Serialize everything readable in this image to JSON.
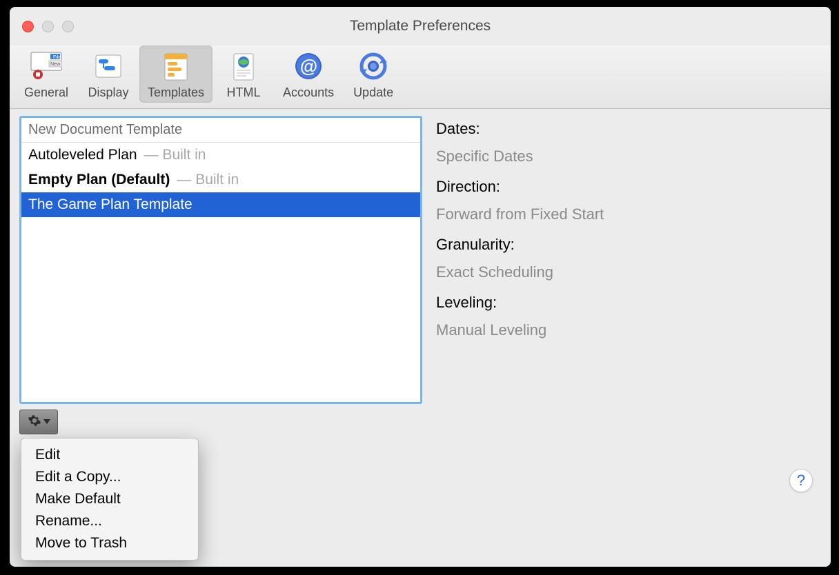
{
  "window": {
    "title": "Template Preferences"
  },
  "toolbar": {
    "items": [
      {
        "label": "General",
        "icon": "general-icon"
      },
      {
        "label": "Display",
        "icon": "display-icon"
      },
      {
        "label": "Templates",
        "icon": "templates-icon"
      },
      {
        "label": "HTML",
        "icon": "html-icon"
      },
      {
        "label": "Accounts",
        "icon": "accounts-icon"
      },
      {
        "label": "Update",
        "icon": "update-icon"
      }
    ],
    "selected_index": 2
  },
  "template_list": {
    "header": "New Document Template",
    "rows": [
      {
        "name": "Autoleveled Plan",
        "suffix": "— Built in",
        "bold": false,
        "selected": false
      },
      {
        "name": "Empty Plan (Default)",
        "suffix": "— Built in",
        "bold": true,
        "selected": false
      },
      {
        "name": "The Game Plan Template",
        "suffix": "",
        "bold": false,
        "selected": true
      }
    ]
  },
  "details": {
    "dates_label": "Dates:",
    "dates_value": "Specific Dates",
    "direction_label": "Direction:",
    "direction_value": "Forward from Fixed Start",
    "granularity_label": "Granularity:",
    "granularity_value": "Exact Scheduling",
    "leveling_label": "Leveling:",
    "leveling_value": "Manual Leveling"
  },
  "context_menu": {
    "items": [
      "Edit",
      "Edit a Copy...",
      "Make Default",
      "Rename...",
      "Move to Trash"
    ]
  },
  "help_glyph": "?",
  "colors": {
    "selection": "#2162d4",
    "list_border": "#7ab5e6"
  }
}
